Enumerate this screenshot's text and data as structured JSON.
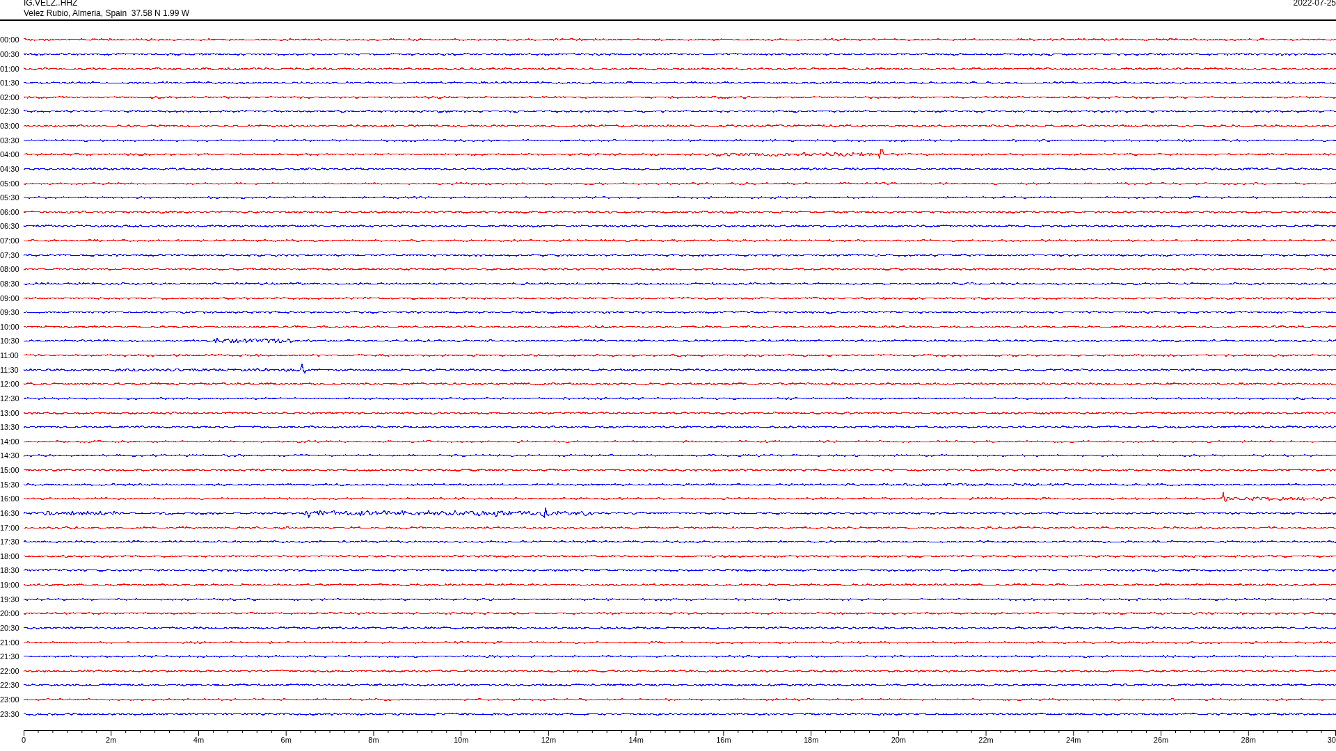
{
  "header": {
    "station": "IG.VELZ..HHZ",
    "location": "Velez Rubio, Almeria, Spain  37.58 N 1.99 W",
    "date": "2022-07-25"
  },
  "rows": [
    {
      "time": "00:00",
      "color": "#ff0000"
    },
    {
      "time": "00:30",
      "color": "#0000ff"
    },
    {
      "time": "01:00",
      "color": "#ff0000"
    },
    {
      "time": "01:30",
      "color": "#0000ff"
    },
    {
      "time": "02:00",
      "color": "#ff0000"
    },
    {
      "time": "02:30",
      "color": "#0000ff"
    },
    {
      "time": "03:00",
      "color": "#ff0000"
    },
    {
      "time": "03:30",
      "color": "#0000ff"
    },
    {
      "time": "04:00",
      "color": "#ff0000"
    },
    {
      "time": "04:30",
      "color": "#0000ff"
    },
    {
      "time": "05:00",
      "color": "#ff0000"
    },
    {
      "time": "05:30",
      "color": "#0000ff"
    },
    {
      "time": "06:00",
      "color": "#ff0000"
    },
    {
      "time": "06:30",
      "color": "#0000ff"
    },
    {
      "time": "07:00",
      "color": "#ff0000"
    },
    {
      "time": "07:30",
      "color": "#0000ff"
    },
    {
      "time": "08:00",
      "color": "#ff0000"
    },
    {
      "time": "08:30",
      "color": "#0000ff"
    },
    {
      "time": "09:00",
      "color": "#ff0000"
    },
    {
      "time": "09:30",
      "color": "#0000ff"
    },
    {
      "time": "10:00",
      "color": "#ff0000"
    },
    {
      "time": "10:30",
      "color": "#0000ff"
    },
    {
      "time": "11:00",
      "color": "#ff0000"
    },
    {
      "time": "11:30",
      "color": "#0000ff"
    },
    {
      "time": "12:00",
      "color": "#ff0000"
    },
    {
      "time": "12:30",
      "color": "#0000ff"
    },
    {
      "time": "13:00",
      "color": "#ff0000"
    },
    {
      "time": "13:30",
      "color": "#0000ff"
    },
    {
      "time": "14:00",
      "color": "#ff0000"
    },
    {
      "time": "14:30",
      "color": "#0000ff"
    },
    {
      "time": "15:00",
      "color": "#ff0000"
    },
    {
      "time": "15:30",
      "color": "#0000ff"
    },
    {
      "time": "16:00",
      "color": "#ff0000"
    },
    {
      "time": "16:30",
      "color": "#0000ff"
    },
    {
      "time": "17:00",
      "color": "#ff0000"
    },
    {
      "time": "17:30",
      "color": "#0000ff"
    },
    {
      "time": "18:00",
      "color": "#ff0000"
    },
    {
      "time": "18:30",
      "color": "#0000ff"
    },
    {
      "time": "19:00",
      "color": "#ff0000"
    },
    {
      "time": "19:30",
      "color": "#0000ff"
    },
    {
      "time": "20:00",
      "color": "#ff0000"
    },
    {
      "time": "20:30",
      "color": "#0000ff"
    },
    {
      "time": "21:00",
      "color": "#ff0000"
    },
    {
      "time": "21:30",
      "color": "#0000ff"
    },
    {
      "time": "22:00",
      "color": "#ff0000"
    },
    {
      "time": "22:30",
      "color": "#0000ff"
    },
    {
      "time": "23:00",
      "color": "#ff0000"
    },
    {
      "time": "23:30",
      "color": "#0000ff"
    }
  ],
  "x_axis": {
    "labels": [
      "0",
      "2m",
      "4m",
      "6m",
      "8m",
      "10m",
      "12m",
      "14m",
      "16m",
      "18m",
      "20m",
      "22m",
      "24m",
      "26m",
      "28m",
      "30"
    ]
  }
}
